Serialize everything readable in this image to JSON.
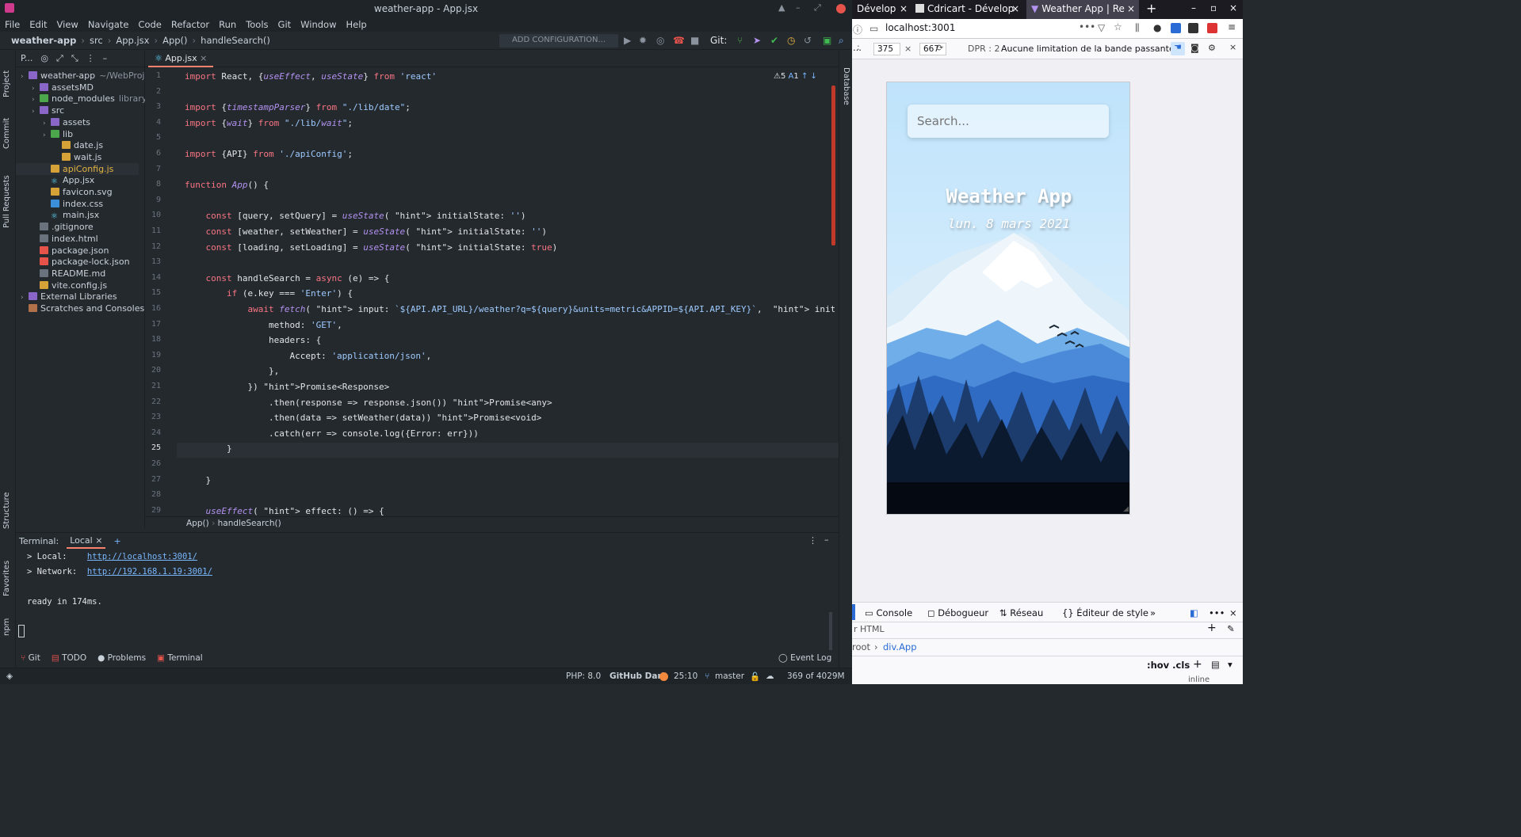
{
  "ide": {
    "title": "weather-app - App.jsx",
    "menu": [
      "File",
      "Edit",
      "View",
      "Navigate",
      "Code",
      "Refactor",
      "Run",
      "Tools",
      "Git",
      "Window",
      "Help"
    ],
    "breadcrumbs": [
      "weather-app",
      "src",
      "App.jsx",
      "App()",
      "handleSearch()"
    ],
    "add_configuration": "ADD CONFIGURATION...",
    "git_label": "Git:",
    "left_tools": [
      "Project",
      "Commit",
      "Pull Requests",
      "Structure",
      "Favorites",
      "npm"
    ],
    "right_tools": [
      "Database"
    ],
    "project_header": "P...",
    "tree": [
      {
        "label": "weather-app",
        "extra": "~/WebProjec",
        "depth": 0,
        "type": "folder"
      },
      {
        "label": "assetsMD",
        "depth": 1,
        "type": "folder"
      },
      {
        "label": "node_modules",
        "extra": "library",
        "depth": 1,
        "type": "folder-green"
      },
      {
        "label": "src",
        "depth": 1,
        "type": "folder"
      },
      {
        "label": "assets",
        "depth": 2,
        "type": "folder"
      },
      {
        "label": "lib",
        "depth": 2,
        "type": "folder-green"
      },
      {
        "label": "date.js",
        "depth": 3,
        "type": "js"
      },
      {
        "label": "wait.js",
        "depth": 3,
        "type": "js"
      },
      {
        "label": "apiConfig.js",
        "depth": 2,
        "type": "js"
      },
      {
        "label": "App.jsx",
        "depth": 2,
        "type": "react"
      },
      {
        "label": "favicon.svg",
        "depth": 2,
        "type": "svg"
      },
      {
        "label": "index.css",
        "depth": 2,
        "type": "css"
      },
      {
        "label": "main.jsx",
        "depth": 2,
        "type": "react"
      },
      {
        "label": ".gitignore",
        "depth": 1,
        "type": "file"
      },
      {
        "label": "index.html",
        "depth": 1,
        "type": "file"
      },
      {
        "label": "package.json",
        "depth": 1,
        "type": "json"
      },
      {
        "label": "package-lock.json",
        "depth": 1,
        "type": "json"
      },
      {
        "label": "README.md",
        "depth": 1,
        "type": "file"
      },
      {
        "label": "vite.config.js",
        "depth": 1,
        "type": "js"
      },
      {
        "label": "External Libraries",
        "depth": 0,
        "type": "lib"
      },
      {
        "label": "Scratches and Consoles",
        "depth": 0,
        "type": "scratch"
      }
    ],
    "tab": "App.jsx",
    "inspections": {
      "warnings": "5",
      "typos": "1"
    },
    "code_lines": [
      {
        "n": "1",
        "t": "import React, {useEffect, useState} from 'react'"
      },
      {
        "n": "2",
        "t": ""
      },
      {
        "n": "3",
        "t": "import {timestampParser} from \"./lib/date\";"
      },
      {
        "n": "4",
        "t": "import {wait} from \"./lib/wait\";"
      },
      {
        "n": "5",
        "t": ""
      },
      {
        "n": "6",
        "t": "import {API} from './apiConfig';"
      },
      {
        "n": "7",
        "t": ""
      },
      {
        "n": "8",
        "t": "function App() {"
      },
      {
        "n": "9",
        "t": ""
      },
      {
        "n": "10",
        "t": "    const [query, setQuery] = useState( initialState: '')"
      },
      {
        "n": "11",
        "t": "    const [weather, setWeather] = useState( initialState: '')"
      },
      {
        "n": "12",
        "t": "    const [loading, setLoading] = useState( initialState: true)"
      },
      {
        "n": "13",
        "t": ""
      },
      {
        "n": "14",
        "t": "    const handleSearch = async (e) => {"
      },
      {
        "n": "15",
        "t": "        if (e.key === 'Enter') {"
      },
      {
        "n": "16",
        "t": "            await fetch( input: `${API.API_URL}/weather?q=${query}&units=metric&APPID=${API.API_KEY}`,  init: {"
      },
      {
        "n": "17",
        "t": "                method: 'GET',"
      },
      {
        "n": "18",
        "t": "                headers: {"
      },
      {
        "n": "19",
        "t": "                    Accept: 'application/json',"
      },
      {
        "n": "20",
        "t": "                },"
      },
      {
        "n": "21",
        "t": "            }) Promise<Response>"
      },
      {
        "n": "22",
        "t": "                .then(response => response.json()) Promise<any>"
      },
      {
        "n": "23",
        "t": "                .then(data => setWeather(data)) Promise<void>"
      },
      {
        "n": "24",
        "t": "                .catch(err => console.log({Error: err}))"
      },
      {
        "n": "25",
        "t": "        }"
      },
      {
        "n": "26",
        "t": ""
      },
      {
        "n": "27",
        "t": "    }"
      },
      {
        "n": "28",
        "t": ""
      },
      {
        "n": "29",
        "t": "    useEffect( effect: () => {"
      }
    ],
    "editor_breadcrumb": [
      "App()",
      "handleSearch()"
    ],
    "terminal": {
      "label": "Terminal:",
      "tab": "Local",
      "local_label": "> Local:",
      "local_url": "http://localhost:3001/",
      "network_label": "> Network:",
      "network_url": "http://192.168.1.19:3001/",
      "ready": "ready in 174ms."
    },
    "bottom_tabs": [
      "Git",
      "TODO",
      "Problems",
      "Terminal"
    ],
    "event_log": "Event Log",
    "status": {
      "php": "PHP: 8.0",
      "theme": "GitHub Dark",
      "pos": "25:10",
      "branch": "master",
      "memory": "369 of 4029M"
    }
  },
  "browser": {
    "tabs": [
      "Dévelop",
      "Cdricart - Dévelop",
      "Weather App | Re"
    ],
    "url": "localhost:3001",
    "width": "375",
    "height": "667",
    "dpr": "DPR : 2",
    "throttle": "Aucune limitation de la bande passante",
    "app": {
      "search_placeholder": "Search...",
      "title": "Weather App",
      "date": "lun. 8 mars 2021"
    },
    "devtools": {
      "tabs": [
        "Console",
        "Débogueur",
        "Réseau",
        "Éditeur de style"
      ],
      "search_html": "r HTML",
      "breadcrumb_root": "root",
      "breadcrumb_node": "div.App",
      "hov": ":hov .cls",
      "inline": "inline"
    }
  },
  "colors": {
    "ide_bg": "#24292e",
    "accent": "#f9826c",
    "link": "#79b8ff",
    "keyword": "#f97583",
    "string": "#9ecbff",
    "function": "#b392f0"
  }
}
